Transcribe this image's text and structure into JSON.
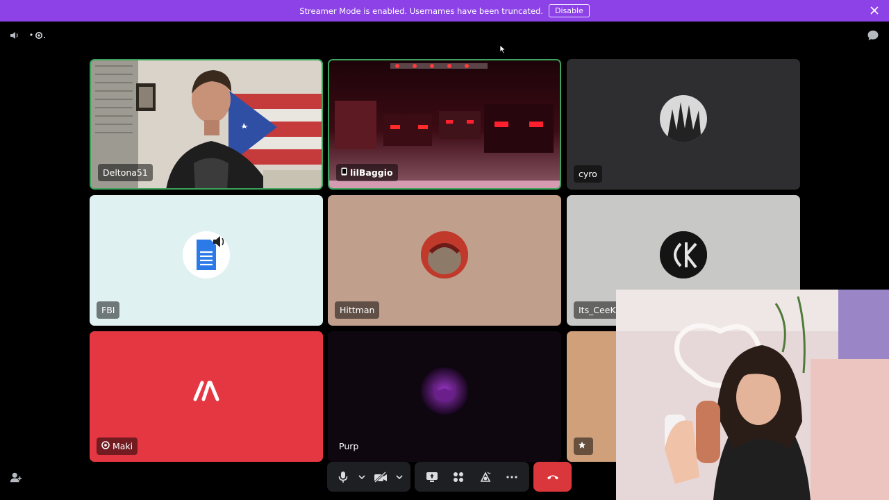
{
  "banner": {
    "message": "Streamer Mode is enabled. Usernames have been truncated.",
    "button_label": "Disable",
    "color": "#8c42e6"
  },
  "header_icons": [
    "speaker-icon",
    "activity-icon",
    "chat-icon"
  ],
  "participants": [
    {
      "name": "Deltona51",
      "speaking": true,
      "video": true
    },
    {
      "name": "lilBaggio",
      "speaking": true,
      "video": true,
      "mobile": true
    },
    {
      "name": "cyro",
      "speaking": false,
      "video": false,
      "bg": "#2e2e31"
    },
    {
      "name": "FBI",
      "speaking": false,
      "video": false,
      "bg": "#dff1f1"
    },
    {
      "name": "Hittman",
      "speaking": false,
      "video": false,
      "bg": "#c09f8c"
    },
    {
      "name": "Its_CeeK",
      "speaking": false,
      "video": false,
      "bg": "#c8c8c6"
    },
    {
      "name": "Maki",
      "speaking": false,
      "video": false,
      "bg": "#e53742",
      "nitro": true
    },
    {
      "name": "Purp",
      "speaking": false,
      "video": false,
      "bg": "#0e0710"
    },
    {
      "name": "",
      "speaking": false,
      "video": false,
      "bg": "#cfa07a",
      "badge": "star-icon"
    }
  ],
  "controls": {
    "left": [
      "microphone-icon",
      "chevron-down-icon",
      "camera-off-icon",
      "chevron-down-icon"
    ],
    "middle": [
      "screen-share-icon",
      "activities-icon",
      "soundboard-icon",
      "more-icon"
    ],
    "end_call": "phone-hangup-icon",
    "end_call_color": "#da373c"
  }
}
